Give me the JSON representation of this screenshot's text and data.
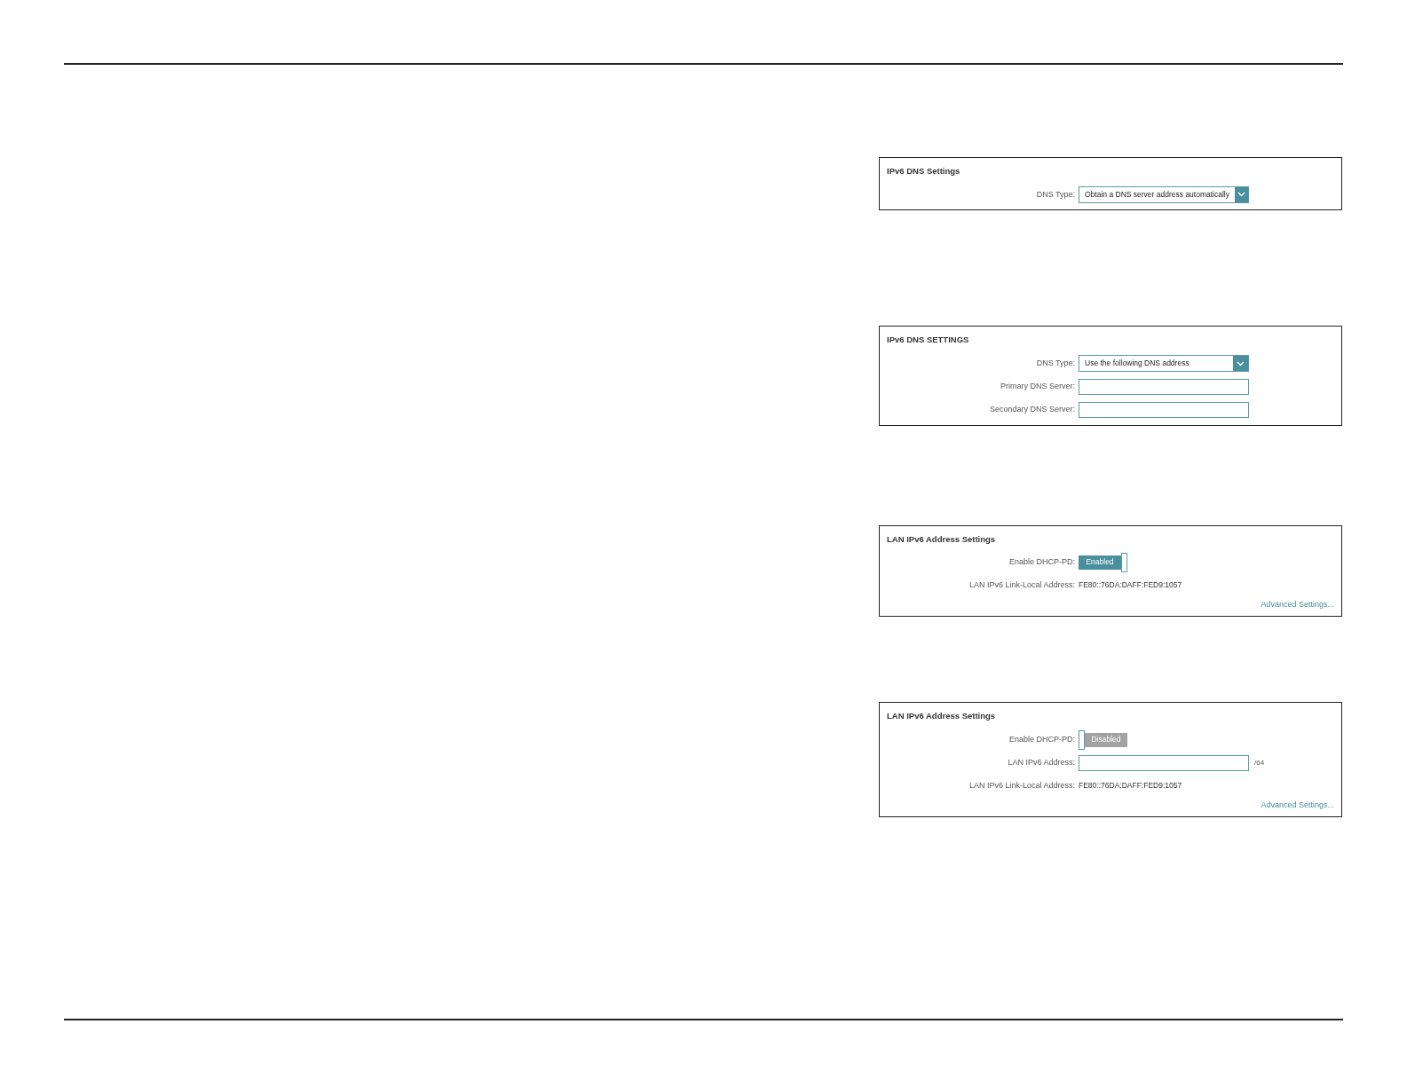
{
  "panels": [
    {
      "title": "IPv6 DNS Settings",
      "rows": [
        {
          "kind": "select",
          "label": "DNS Type:",
          "value": "Obtain a DNS server address automatically"
        }
      ]
    },
    {
      "title": "IPv6 DNS SETTINGS",
      "rows": [
        {
          "kind": "select",
          "label": "DNS Type:",
          "value": "Use the following DNS address"
        },
        {
          "kind": "input",
          "label": "Primary DNS Server:"
        },
        {
          "kind": "input",
          "label": "Secondary DNS Server:"
        }
      ]
    },
    {
      "title": "LAN IPv6 Address Settings",
      "rows": [
        {
          "kind": "toggle",
          "label": "Enable DHCP-PD:",
          "on": true,
          "value": "Enabled"
        },
        {
          "kind": "text",
          "label": "LAN IPv6 Link-Local Address:",
          "value": "FE80::76DA:DAFF:FED9:1057"
        }
      ],
      "link": "Advanced Settings..."
    },
    {
      "title": "LAN IPv6 Address Settings",
      "rows": [
        {
          "kind": "toggle",
          "label": "Enable DHCP-PD:",
          "on": false,
          "value": "Disabled"
        },
        {
          "kind": "input",
          "label": "LAN IPv6 Address:",
          "suffix": "/64"
        },
        {
          "kind": "text",
          "label": "LAN IPv6 Link-Local Address:",
          "value": "FE80::76DA:DAFF:FED9:1057"
        }
      ],
      "link": "Advanced Settings..."
    }
  ]
}
